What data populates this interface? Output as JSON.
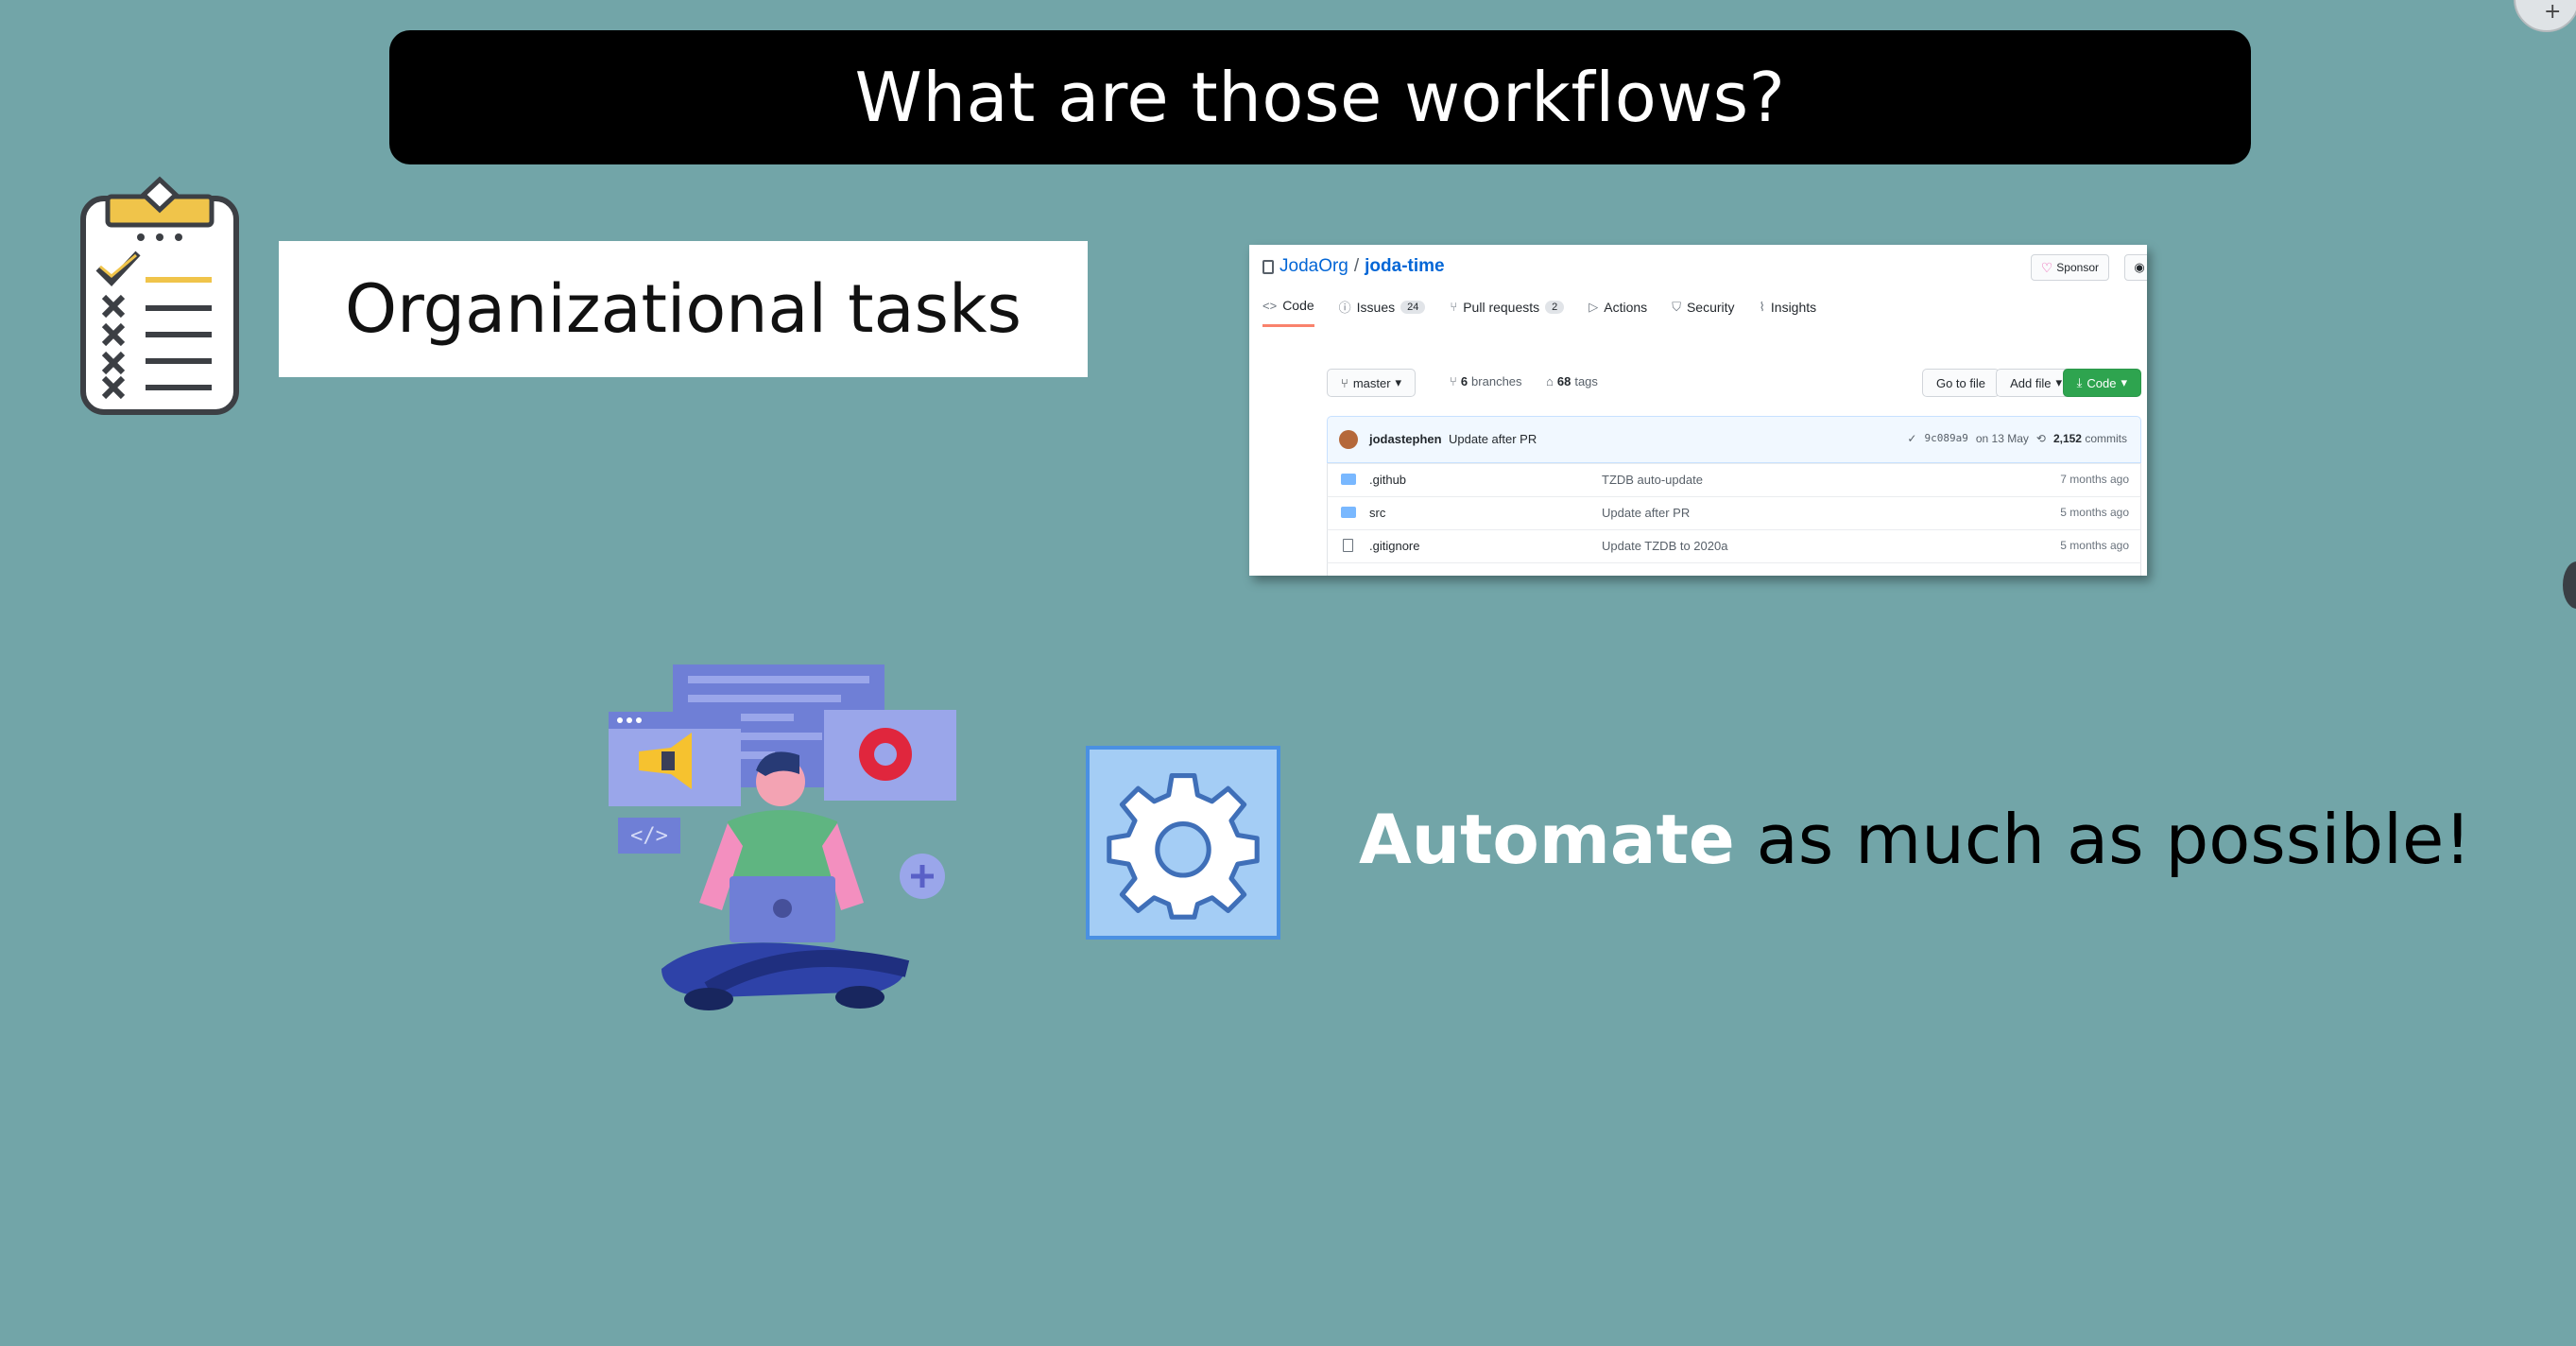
{
  "slide": {
    "title": "What are those workflows?",
    "organizational_label": "Organizational tasks",
    "automate_highlight": "Automate",
    "automate_rest": " as much as possible!",
    "colors": {
      "background": "#72a5a8",
      "title_bar": "#000000",
      "highlight": "#ffffff",
      "gear_box": "#a4cdf5"
    }
  },
  "github": {
    "owner": "JodaOrg",
    "separator": "/",
    "repo": "joda-time",
    "sponsor_label": "Sponsor",
    "tabs": [
      {
        "label": "Code",
        "icon": "code-icon"
      },
      {
        "label": "Issues",
        "count": "24",
        "icon": "issue-icon"
      },
      {
        "label": "Pull requests",
        "count": "2",
        "icon": "pull-request-icon"
      },
      {
        "label": "Actions",
        "icon": "play-icon"
      },
      {
        "label": "Security",
        "icon": "shield-icon"
      },
      {
        "label": "Insights",
        "icon": "graph-icon"
      }
    ],
    "branch_button": "master",
    "branches_count": "6",
    "branches_label": "branches",
    "tags_count": "68",
    "tags_label": "tags",
    "go_to_file": "Go to file",
    "add_file": "Add file",
    "code_button": "Code",
    "commit": {
      "author": "jodastephen",
      "message": "Update after PR",
      "hash": "9c089a9",
      "date": "on 13 May",
      "commits_count": "2,152",
      "commits_label": "commits"
    },
    "files": [
      {
        "name": ".github",
        "type": "folder",
        "message": "TZDB auto-update",
        "age": "7 months ago"
      },
      {
        "name": "src",
        "type": "folder",
        "message": "Update after PR",
        "age": "5 months ago"
      },
      {
        "name": ".gitignore",
        "type": "file",
        "message": "Update TZDB to 2020a",
        "age": "5 months ago"
      }
    ]
  }
}
